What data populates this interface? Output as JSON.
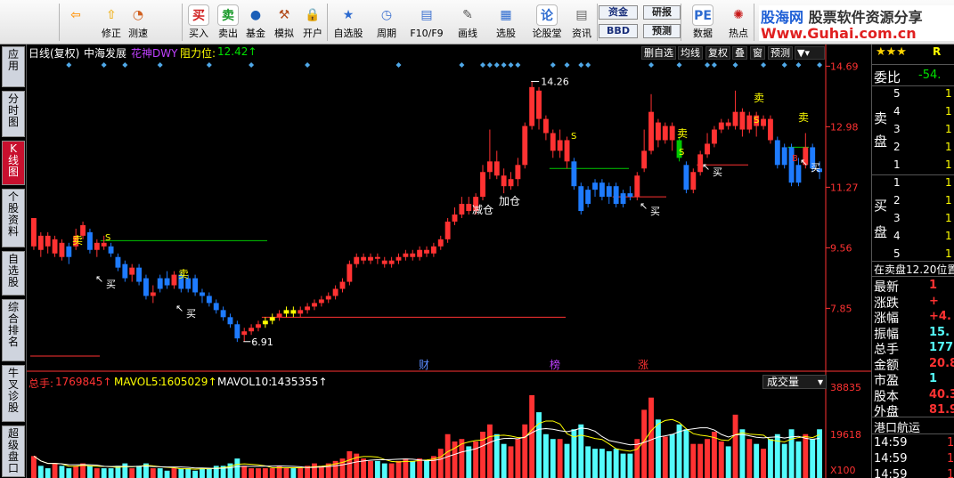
{
  "toolbar": {
    "items": [
      {
        "label": "",
        "icon": "back-arrow-icon"
      },
      {
        "label": "修正",
        "icon": "adjust-icon"
      },
      {
        "label": "测速",
        "icon": "speedometer-icon"
      },
      {
        "label": "买入",
        "icon": "buy-icon",
        "glyph": "买"
      },
      {
        "label": "卖出",
        "icon": "sell-icon",
        "glyph": "卖"
      },
      {
        "label": "基金",
        "icon": "fund-icon"
      },
      {
        "label": "模拟",
        "icon": "gavel-icon"
      },
      {
        "label": "开户",
        "icon": "lock-icon"
      },
      {
        "label": "自选股",
        "icon": "star-folder-icon"
      },
      {
        "label": "周期",
        "icon": "clock-icon"
      },
      {
        "label": "F10/F9",
        "icon": "f10-icon"
      },
      {
        "label": "画线",
        "icon": "pencil-icon"
      },
      {
        "label": "选股",
        "icon": "screen-icon"
      },
      {
        "label": "论股堂",
        "icon": "forum-icon",
        "glyph": "论"
      },
      {
        "label": "资讯",
        "icon": "news-icon"
      },
      {
        "label": "数据",
        "icon": "pe-data-icon",
        "glyph": "PE"
      },
      {
        "label": "热点",
        "icon": "hot-icon"
      }
    ],
    "fund_label": "资金",
    "bbd_label": "BBD",
    "research_label": "研报",
    "forecast_label": "预测"
  },
  "brand": {
    "title": "股海网",
    "slogan": "股票软件资源分享",
    "url": "Www.Guhai.com.cn"
  },
  "sidebar": {
    "tabs": [
      "应用",
      "分时图",
      "K线图",
      "个股资料",
      "自选股",
      "综合排名",
      "牛叉诊股",
      "超级盘口"
    ],
    "active": 2
  },
  "chart_header": {
    "period": "日线(复权)",
    "stock_name": "中海发展",
    "indicator": "花神DWY",
    "resistance_label": "阻力位:",
    "resistance_value": "12.42↑"
  },
  "chart_buttons": [
    "删自选",
    "均线",
    "复权",
    "叠",
    "窗",
    "预测"
  ],
  "price_axis": [
    "14.69",
    "12.98",
    "11.27",
    "9.56",
    "7.85"
  ],
  "volume_header": {
    "total_label": "总手:",
    "total": "1769845↑",
    "mavol5_label": "MAVOL5:",
    "mavol5": "1605029↑",
    "mavol10_label": "MAVOL10:",
    "mavol10": "1435355↑",
    "selector": "成交量"
  },
  "volume_axis": [
    "38835",
    "19618",
    "X100"
  ],
  "annotations": {
    "high": "14.26",
    "low": "6.91",
    "sell": "卖",
    "buy": "买",
    "s": "S",
    "b": "B",
    "jiancang": "减仓",
    "jiacang": "加仓",
    "cai": "财",
    "bang": "榜",
    "zhang": "涨"
  },
  "right_panel": {
    "stars": "★★★",
    "r_label": "R",
    "weibi_label": "委比",
    "weibi_value": "-54.",
    "sell_label": "卖盘",
    "buy_label": "买盘",
    "sell_rows": [
      {
        "n": "5",
        "v": "1"
      },
      {
        "n": "4",
        "v": "1"
      },
      {
        "n": "3",
        "v": "1"
      },
      {
        "n": "2",
        "v": "1"
      },
      {
        "n": "1",
        "v": "1"
      }
    ],
    "buy_rows": [
      {
        "n": "1",
        "v": "1"
      },
      {
        "n": "2",
        "v": "1"
      },
      {
        "n": "3",
        "v": "1"
      },
      {
        "n": "4",
        "v": "1"
      },
      {
        "n": "5",
        "v": "1"
      }
    ],
    "position_note": "在卖盘12.20位置",
    "stats": [
      {
        "k": "最新",
        "v": "1"
      },
      {
        "k": "涨跌",
        "v": "+"
      },
      {
        "k": "涨幅",
        "v": "+4."
      },
      {
        "k": "振幅",
        "v": "15."
      },
      {
        "k": "总手",
        "v": "177"
      },
      {
        "k": "金额",
        "v": "20.8"
      },
      {
        "k": "市盈",
        "v": "1"
      },
      {
        "k": "股本",
        "v": "40.3"
      },
      {
        "k": "外盘",
        "v": "81.9"
      }
    ],
    "industry": "港口航运",
    "ticks": [
      {
        "t": "14:59",
        "v": "1"
      },
      {
        "t": "14:59",
        "v": "1"
      },
      {
        "t": "14:59",
        "v": "1"
      }
    ]
  },
  "colors": {
    "up": "#ff3232",
    "down": "#54fcfc",
    "blue_candle": "#1e7bff",
    "yellow": "#ffff00",
    "green": "#00c800",
    "axis": "#ff3232",
    "volume_up": "#ff3232",
    "volume_cyan": "#54fcfc"
  },
  "chart_data": {
    "type": "candlestick",
    "price_range": [
      6.2,
      14.9
    ],
    "ticks": [
      14.69,
      12.98,
      11.27,
      9.56,
      7.85
    ],
    "high": 14.26,
    "low": 6.91,
    "resistance": 12.42,
    "volume_ticks": [
      38835,
      19618
    ],
    "volume_unit": "X100",
    "total_volume": 1769845,
    "mavol5": 1605029,
    "mavol10": 1435355
  },
  "candles": [
    [
      10.4,
      9.6,
      10.4,
      9.5,
      "r"
    ],
    [
      9.9,
      9.5,
      10.0,
      9.3,
      "r"
    ],
    [
      9.6,
      9.9,
      10.0,
      9.4,
      "r"
    ],
    [
      9.8,
      9.4,
      9.9,
      9.3,
      "r"
    ],
    [
      9.7,
      9.3,
      9.8,
      9.2,
      "r"
    ],
    [
      9.6,
      9.3,
      9.7,
      9.1,
      "b"
    ],
    [
      9.6,
      9.9,
      10.1,
      9.5,
      "r"
    ],
    [
      9.9,
      10.2,
      10.3,
      9.8,
      "r"
    ],
    [
      10.0,
      9.5,
      10.1,
      9.4,
      "b"
    ],
    [
      9.5,
      9.7,
      9.8,
      9.3,
      "r"
    ],
    [
      9.7,
      9.6,
      9.9,
      9.5,
      "r"
    ],
    [
      9.6,
      9.4,
      9.7,
      9.3,
      "b"
    ],
    [
      9.3,
      9.0,
      9.4,
      8.9,
      "b"
    ],
    [
      9.1,
      8.7,
      9.2,
      8.6,
      "b"
    ],
    [
      8.8,
      9.0,
      9.1,
      8.6,
      "r"
    ],
    [
      9.0,
      8.6,
      9.1,
      8.5,
      "b"
    ],
    [
      8.7,
      8.2,
      8.8,
      8.1,
      "b"
    ],
    [
      8.2,
      8.3,
      8.5,
      8.0,
      "r"
    ],
    [
      8.4,
      8.7,
      8.8,
      8.3,
      "b"
    ],
    [
      8.7,
      8.5,
      8.9,
      8.4,
      "b"
    ],
    [
      8.5,
      8.8,
      8.9,
      8.4,
      "r"
    ],
    [
      8.8,
      8.4,
      8.9,
      8.3,
      "b"
    ],
    [
      8.4,
      8.7,
      8.8,
      8.3,
      "b"
    ],
    [
      8.7,
      8.3,
      8.8,
      8.2,
      "b"
    ],
    [
      8.3,
      8.2,
      8.4,
      8.0,
      "b"
    ],
    [
      8.2,
      8.0,
      8.3,
      7.9,
      "b"
    ],
    [
      8.0,
      7.8,
      8.1,
      7.7,
      "b"
    ],
    [
      7.8,
      7.6,
      7.9,
      7.5,
      "b"
    ],
    [
      7.6,
      7.4,
      7.7,
      7.3,
      "b"
    ],
    [
      7.4,
      7.0,
      7.5,
      6.9,
      "b"
    ],
    [
      7.1,
      7.2,
      7.3,
      6.91,
      "r"
    ],
    [
      7.2,
      7.3,
      7.4,
      7.1,
      "r"
    ],
    [
      7.3,
      7.4,
      7.5,
      7.2,
      "r"
    ],
    [
      7.4,
      7.5,
      7.6,
      7.3,
      "y"
    ],
    [
      7.5,
      7.6,
      7.7,
      7.4,
      "y"
    ],
    [
      7.6,
      7.7,
      7.8,
      7.5,
      "r"
    ],
    [
      7.7,
      7.8,
      7.9,
      7.6,
      "y"
    ],
    [
      7.8,
      7.7,
      7.9,
      7.6,
      "y"
    ],
    [
      7.7,
      7.8,
      7.9,
      7.6,
      "r"
    ],
    [
      7.8,
      7.9,
      8.0,
      7.7,
      "r"
    ],
    [
      7.9,
      8.0,
      8.1,
      7.8,
      "r"
    ],
    [
      8.0,
      8.1,
      8.2,
      7.9,
      "r"
    ],
    [
      8.1,
      8.2,
      8.3,
      8.0,
      "r"
    ],
    [
      8.2,
      8.4,
      8.5,
      8.1,
      "r"
    ],
    [
      8.4,
      8.6,
      8.7,
      8.3,
      "r"
    ],
    [
      8.6,
      9.1,
      9.2,
      8.5,
      "r"
    ],
    [
      9.1,
      9.3,
      9.4,
      9.0,
      "r"
    ],
    [
      9.3,
      9.2,
      9.4,
      9.1,
      "r"
    ],
    [
      9.2,
      9.3,
      9.4,
      9.1,
      "r"
    ],
    [
      9.3,
      9.25,
      9.4,
      9.1,
      "r"
    ],
    [
      9.2,
      9.1,
      9.3,
      9.0,
      "r"
    ],
    [
      9.1,
      9.2,
      9.3,
      9.0,
      "r"
    ],
    [
      9.2,
      9.3,
      9.4,
      9.1,
      "r"
    ],
    [
      9.3,
      9.4,
      9.5,
      9.2,
      "r"
    ],
    [
      9.4,
      9.3,
      9.5,
      9.2,
      "r"
    ],
    [
      9.3,
      9.5,
      9.6,
      9.2,
      "r"
    ],
    [
      9.5,
      9.4,
      9.6,
      9.3,
      "r"
    ],
    [
      9.4,
      9.6,
      9.7,
      9.3,
      "r"
    ],
    [
      9.6,
      9.8,
      9.9,
      9.5,
      "r"
    ],
    [
      9.8,
      10.3,
      10.4,
      9.7,
      "r"
    ],
    [
      10.3,
      10.5,
      10.7,
      10.2,
      "r"
    ],
    [
      10.5,
      10.8,
      11.0,
      10.4,
      "r"
    ],
    [
      10.8,
      10.6,
      11.0,
      10.5,
      "r"
    ],
    [
      10.6,
      11.0,
      11.1,
      10.5,
      "r"
    ],
    [
      11.0,
      11.7,
      11.9,
      10.9,
      "r"
    ],
    [
      11.7,
      12.0,
      12.9,
      11.5,
      "r"
    ],
    [
      12.0,
      11.6,
      12.3,
      11.5,
      "r"
    ],
    [
      11.6,
      11.3,
      11.8,
      11.1,
      "r"
    ],
    [
      11.3,
      11.5,
      11.7,
      11.2,
      "r"
    ],
    [
      11.5,
      11.9,
      12.1,
      11.3,
      "r"
    ],
    [
      11.9,
      13.0,
      13.1,
      11.8,
      "r"
    ],
    [
      13.0,
      14.1,
      14.26,
      12.9,
      "r"
    ],
    [
      14.0,
      13.2,
      14.1,
      12.9,
      "r"
    ],
    [
      13.2,
      12.8,
      13.3,
      12.6,
      "r"
    ],
    [
      12.8,
      12.3,
      12.9,
      12.1,
      "r"
    ],
    [
      12.3,
      12.6,
      12.9,
      12.1,
      "r"
    ],
    [
      12.6,
      12.0,
      12.7,
      11.8,
      "r"
    ],
    [
      12.0,
      11.3,
      12.1,
      11.2,
      "b"
    ],
    [
      11.3,
      10.6,
      11.4,
      10.5,
      "b"
    ],
    [
      10.8,
      11.2,
      11.3,
      10.7,
      "b"
    ],
    [
      11.2,
      11.4,
      11.5,
      11.0,
      "b"
    ],
    [
      11.4,
      11.0,
      11.5,
      10.9,
      "b"
    ],
    [
      11.0,
      11.3,
      11.4,
      10.8,
      "b"
    ],
    [
      11.3,
      10.8,
      11.4,
      10.7,
      "b"
    ],
    [
      10.8,
      11.1,
      11.2,
      10.7,
      "b"
    ],
    [
      11.1,
      11.0,
      11.3,
      10.9,
      "b"
    ],
    [
      11.0,
      11.6,
      11.7,
      10.9,
      "r"
    ],
    [
      11.8,
      12.3,
      12.9,
      11.7,
      "r"
    ],
    [
      12.3,
      13.4,
      13.9,
      12.2,
      "r"
    ],
    [
      13.1,
      12.6,
      13.2,
      12.4,
      "r"
    ],
    [
      12.6,
      13.0,
      13.1,
      12.5,
      "r"
    ],
    [
      13.0,
      12.6,
      13.1,
      12.3,
      "r"
    ],
    [
      12.6,
      12.1,
      12.7,
      12.0,
      "g"
    ],
    [
      11.9,
      11.2,
      12.0,
      11.1,
      "b"
    ],
    [
      11.2,
      11.7,
      11.8,
      11.1,
      "r"
    ],
    [
      11.7,
      12.2,
      12.3,
      11.6,
      "r"
    ],
    [
      12.2,
      12.5,
      12.8,
      12.1,
      "r"
    ],
    [
      12.5,
      12.9,
      13.0,
      12.4,
      "r"
    ],
    [
      12.9,
      13.1,
      13.2,
      12.8,
      "r"
    ],
    [
      13.1,
      13.0,
      13.2,
      12.9,
      "r"
    ],
    [
      13.0,
      13.4,
      14.0,
      12.9,
      "r"
    ],
    [
      13.4,
      12.9,
      13.5,
      12.7,
      "r"
    ],
    [
      12.9,
      13.3,
      13.4,
      12.8,
      "r"
    ],
    [
      13.3,
      13.0,
      13.4,
      12.7,
      "r"
    ],
    [
      13.0,
      13.2,
      13.3,
      12.9,
      "r"
    ],
    [
      13.2,
      12.6,
      13.3,
      12.5,
      "r"
    ],
    [
      12.6,
      11.9,
      12.7,
      11.8,
      "b"
    ],
    [
      11.9,
      12.4,
      12.5,
      11.8,
      "b"
    ],
    [
      12.4,
      11.4,
      12.5,
      11.3,
      "b"
    ],
    [
      11.4,
      11.9,
      12.1,
      11.3,
      "b"
    ],
    [
      11.9,
      12.4,
      12.8,
      11.8,
      "r"
    ],
    [
      12.4,
      11.8,
      12.5,
      11.7,
      "b"
    ],
    [
      11.8,
      11.7,
      12.0,
      11.5,
      "b"
    ]
  ],
  "volumes": [
    [
      9,
      "r"
    ],
    [
      5,
      "c"
    ],
    [
      4,
      "c"
    ],
    [
      6,
      "r"
    ],
    [
      5,
      "c"
    ],
    [
      4,
      "c"
    ],
    [
      5,
      "r"
    ],
    [
      6,
      "r"
    ],
    [
      5,
      "c"
    ],
    [
      4,
      "r"
    ],
    [
      4,
      "c"
    ],
    [
      4,
      "c"
    ],
    [
      5,
      "c"
    ],
    [
      6,
      "c"
    ],
    [
      4,
      "r"
    ],
    [
      5,
      "c"
    ],
    [
      6,
      "c"
    ],
    [
      4,
      "r"
    ],
    [
      4,
      "c"
    ],
    [
      3,
      "c"
    ],
    [
      4,
      "r"
    ],
    [
      4,
      "c"
    ],
    [
      4,
      "c"
    ],
    [
      3,
      "c"
    ],
    [
      4,
      "c"
    ],
    [
      4,
      "c"
    ],
    [
      5,
      "c"
    ],
    [
      5,
      "c"
    ],
    [
      6,
      "c"
    ],
    [
      8,
      "c"
    ],
    [
      5,
      "r"
    ],
    [
      4,
      "r"
    ],
    [
      4,
      "r"
    ],
    [
      4,
      "r"
    ],
    [
      4,
      "r"
    ],
    [
      5,
      "r"
    ],
    [
      4,
      "r"
    ],
    [
      4,
      "c"
    ],
    [
      4,
      "r"
    ],
    [
      5,
      "r"
    ],
    [
      6,
      "r"
    ],
    [
      5,
      "r"
    ],
    [
      6,
      "r"
    ],
    [
      7,
      "r"
    ],
    [
      8,
      "r"
    ],
    [
      11,
      "r"
    ],
    [
      10,
      "r"
    ],
    [
      8,
      "r"
    ],
    [
      7,
      "r"
    ],
    [
      7,
      "c"
    ],
    [
      6,
      "c"
    ],
    [
      6,
      "r"
    ],
    [
      7,
      "r"
    ],
    [
      8,
      "r"
    ],
    [
      7,
      "c"
    ],
    [
      8,
      "r"
    ],
    [
      7,
      "c"
    ],
    [
      9,
      "r"
    ],
    [
      12,
      "r"
    ],
    [
      18,
      "r"
    ],
    [
      15,
      "r"
    ],
    [
      16,
      "r"
    ],
    [
      13,
      "c"
    ],
    [
      15,
      "r"
    ],
    [
      19,
      "r"
    ],
    [
      22,
      "r"
    ],
    [
      18,
      "c"
    ],
    [
      14,
      "c"
    ],
    [
      13,
      "r"
    ],
    [
      16,
      "r"
    ],
    [
      22,
      "r"
    ],
    [
      34,
      "r"
    ],
    [
      27,
      "c"
    ],
    [
      18,
      "c"
    ],
    [
      16,
      "c"
    ],
    [
      16,
      "r"
    ],
    [
      14,
      "c"
    ],
    [
      20,
      "c"
    ],
    [
      22,
      "c"
    ],
    [
      13,
      "c"
    ],
    [
      12,
      "c"
    ],
    [
      12,
      "c"
    ],
    [
      11,
      "c"
    ],
    [
      12,
      "c"
    ],
    [
      10,
      "c"
    ],
    [
      10,
      "c"
    ],
    [
      16,
      "r"
    ],
    [
      28,
      "r"
    ],
    [
      33,
      "r"
    ],
    [
      24,
      "c"
    ],
    [
      17,
      "r"
    ],
    [
      18,
      "c"
    ],
    [
      22,
      "c"
    ],
    [
      20,
      "c"
    ],
    [
      14,
      "r"
    ],
    [
      14,
      "r"
    ],
    [
      16,
      "r"
    ],
    [
      19,
      "r"
    ],
    [
      15,
      "r"
    ],
    [
      13,
      "c"
    ],
    [
      26,
      "r"
    ],
    [
      20,
      "c"
    ],
    [
      16,
      "r"
    ],
    [
      14,
      "c"
    ],
    [
      12,
      "r"
    ],
    [
      16,
      "c"
    ],
    [
      18,
      "c"
    ],
    [
      14,
      "c"
    ],
    [
      20,
      "c"
    ],
    [
      15,
      "c"
    ],
    [
      18,
      "r"
    ],
    [
      16,
      "c"
    ],
    [
      20,
      "c"
    ]
  ]
}
